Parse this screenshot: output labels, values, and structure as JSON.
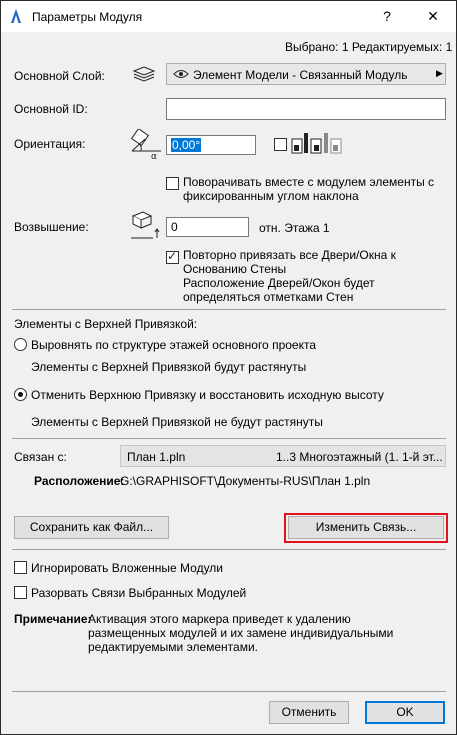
{
  "window": {
    "title": "Параметры Модуля",
    "help_label": "?",
    "close_label": "✕"
  },
  "selection_info": "Выбрано: 1 Редактируемых: 1",
  "main_layer": {
    "label": "Основной Слой:",
    "value": "Элемент Модели - Связанный Модуль"
  },
  "main_id": {
    "label": "Основной ID:",
    "value": ""
  },
  "orientation": {
    "label": "Ориентация:",
    "value": "0,00°",
    "rotate_label": "Поворачивать вместе с модулем элементы с фиксированным углом наклона"
  },
  "elevation": {
    "label": "Возвышение:",
    "value": "0",
    "ref_label": "отн. Этажа 1",
    "reattach_label": "Повторно привязать все Двери/Окна к Основанию Стены",
    "reattach_note": "Расположение Дверей/Окон будет определяться отметками Стен"
  },
  "top_linked": {
    "heading": "Элементы с Верхней Привязкой:",
    "option1_label": "Выровнять по структуре этажей основного проекта",
    "option1_note": "Элементы с Верхней Привязкой будут растянуты",
    "option2_label": "Отменить Верхнюю Привязку и восстановить исходную высоту",
    "option2_note": "Элементы с Верхней Привязкой не будут растянуты"
  },
  "link": {
    "label": "Связан с:",
    "file": "План 1.pln",
    "story": "1..3 Многоэтажный (1. 1-й эт...",
    "location_label": "Расположение:",
    "location": "G:\\GRAPHISOFT\\Документы-RUS\\План 1.pln"
  },
  "buttons": {
    "save_as_file": "Сохранить как Файл...",
    "change_link": "Изменить Связь...",
    "cancel": "Отменить",
    "ok": "OK"
  },
  "options": {
    "ignore_nested": "Игнорировать Вложенные Модули",
    "break_links": "Разорвать Связи Выбранных Модулей"
  },
  "note": {
    "label": "Примечание:",
    "text": "Активация этого маркера приведет к удалению размещенных модулей и их замене индивидуальными редактируемыми элементами."
  },
  "colors": {
    "highlight": "#e0141e",
    "focus_blue": "#0078d7",
    "dialog_bg": "#f0f0f0"
  },
  "icons": [
    "app-logo-icon",
    "layer-stack-icon",
    "eye-icon",
    "arrow-right-icon",
    "orientation-angle-icon",
    "mirror-preview-icon",
    "elevation-icon",
    "check-icon"
  ]
}
